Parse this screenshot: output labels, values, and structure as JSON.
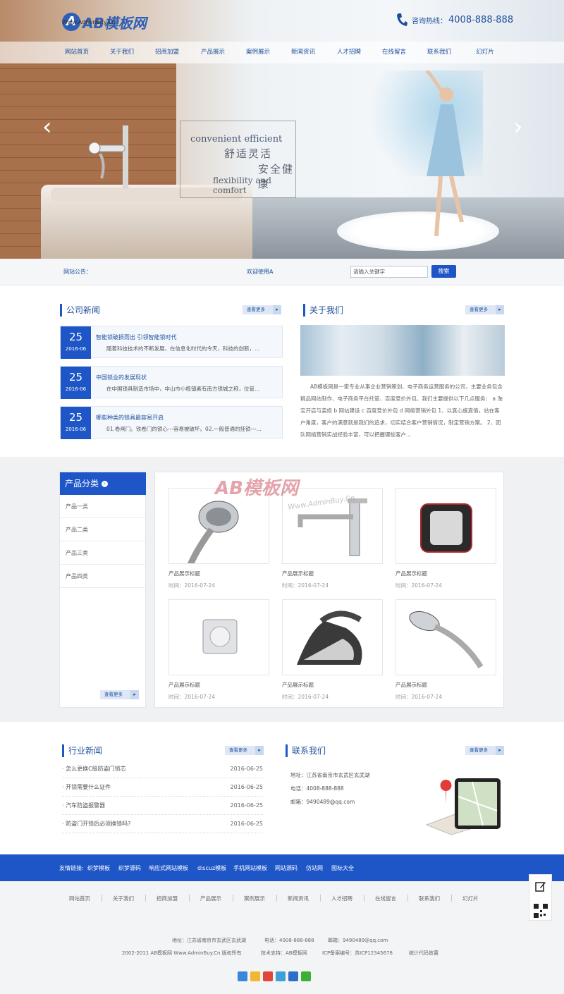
{
  "header": {
    "logo_text": "AB模板网",
    "logo_sub": "Www.AdminBuy.Cn",
    "hotline_label": "咨询热线：",
    "hotline_number": "4008-888-888"
  },
  "nav": [
    "网站首页",
    "关于我们",
    "招商加盟",
    "产品展示",
    "案例展示",
    "新闻资讯",
    "人才招聘",
    "在线留言",
    "联系我们",
    "幻灯片"
  ],
  "banner": {
    "line1": "convenient efficient",
    "line2": "舒适灵活",
    "line3": "安全健康",
    "line4": "flexibility and comfort"
  },
  "notice": {
    "label": "网站公告：",
    "text": "欢迎使用A",
    "search_placeholder": "请输入关键字",
    "search_button": "搜索"
  },
  "company_news": {
    "title": "公司新闻",
    "more": "查看更多",
    "items": [
      {
        "day": "25",
        "month": "2016-06",
        "title": "智能锁破损而出 引领智能锁时代",
        "desc": "随着科技技术的不断发展，在信息化时代的今天，科技的创新，..."
      },
      {
        "day": "25",
        "month": "2016-06",
        "title": "中国锁业的发展现状",
        "desc": "在中国锁具制造市场中，中山市小榄镇素有南方锁城之称，位管..."
      },
      {
        "day": "25",
        "month": "2016-06",
        "title": "哪些种类的锁具最容易开启",
        "desc": "01.卷闸门。铁卷门的锁心---容易被破坏。02.一般普通的挂锁---..."
      }
    ]
  },
  "about": {
    "title": "关于我们",
    "more": "查看更多",
    "text": "AB模板网是一家专业从事企业营销策划、电子商务运营服务的公司，主要业务包含精品网站制作、电子商务平台托管、百度竞价外包、我们主要提供以下几点服务： a 淘宝开店与装修 b 网站建设 c 百度竞价外包 d 网络营销外包 1、以真心施真情，站在客户角度，客户的满意就是我们的追求，切实结合客户营销情况，制定营销方案。 2、团队网络营销实战经验丰富，可以把握哪些客户..."
  },
  "categories": {
    "title": "产品分类",
    "items": [
      "产品一类",
      "产品二类",
      "产品三类",
      "产品四类"
    ],
    "more": "查看更多"
  },
  "products": [
    {
      "name": "产品展示标题",
      "time": "时间：2016-07-24",
      "icon": "shower-head"
    },
    {
      "name": "产品展示标题",
      "time": "时间：2016-07-24",
      "icon": "faucet"
    },
    {
      "name": "产品展示标题",
      "time": "时间：2016-07-24",
      "icon": "toaster"
    },
    {
      "name": "产品展示标题",
      "time": "时间：2016-07-24",
      "icon": "drain"
    },
    {
      "name": "产品展示标题",
      "time": "时间：2016-07-24",
      "icon": "iron"
    },
    {
      "name": "产品展示标题",
      "time": "时间：2016-07-24",
      "icon": "shower-head"
    }
  ],
  "watermark": {
    "text": "AB模板网",
    "sub": "Www.AdminBuy.Cn"
  },
  "industry_news": {
    "title": "行业新闻",
    "more": "查看更多",
    "items": [
      {
        "title": "怎么更换C级防盗门锁芯",
        "date": "2016-06-25"
      },
      {
        "title": "开锁需要什么证件",
        "date": "2016-06-25"
      },
      {
        "title": "汽车防盗报警器",
        "date": "2016-06-25"
      },
      {
        "title": "防盗门开锁后必须换锁吗?",
        "date": "2016-06-25"
      }
    ]
  },
  "contact": {
    "title": "联系我们",
    "more": "查看更多",
    "address": "地址：江苏省南京市玄武区玄武湖",
    "phone": "电话：4008-888-888",
    "email": "邮箱：9490489@qq.com"
  },
  "friend_links": {
    "label": "友情链接:",
    "items": [
      "织梦模板",
      "织梦源码",
      "响应式网站模板",
      "discuz模板",
      "手机网站模板",
      "网站源码",
      "仿站网",
      "图标大全"
    ]
  },
  "footer": {
    "nav": [
      "网站首页",
      "关于我们",
      "招商加盟",
      "产品展示",
      "案例展示",
      "新闻资讯",
      "人才招聘",
      "在线留言",
      "联系我们",
      "幻灯片"
    ],
    "address": "地址：江苏省南京市玄武区玄武湖",
    "phone": "电话：4008-888-888",
    "email": "邮箱：9490489@qq.com",
    "copyright": "2002-2011 AB模板网 Www.AdminBuy.Cn 版权所有",
    "support": "技术支持：AB模板网",
    "icp": "ICP备案编号：苏ICP12345678",
    "stats": "统计代码放置"
  },
  "colors": {
    "primary": "#1f56c7",
    "text": "#1e4f9c"
  }
}
